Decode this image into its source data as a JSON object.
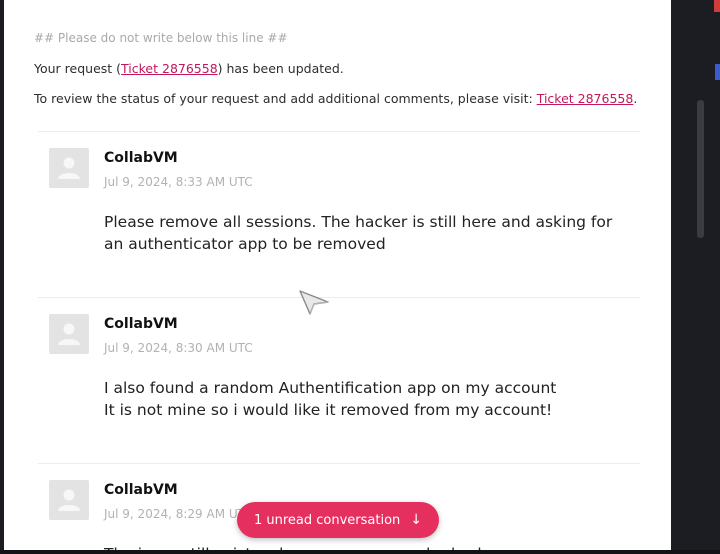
{
  "email": {
    "notice": "## Please do not write below this line ##",
    "line1": {
      "before": "Your request (",
      "link": "Ticket 2876558",
      "after": ") has been updated."
    },
    "line2": {
      "before": "To review the status of your request and add additional comments, please visit: ",
      "link": "Ticket 2876558",
      "after": "."
    },
    "comments": [
      {
        "author": "CollabVM",
        "timestamp": "Jul 9, 2024, 8:33 AM UTC",
        "lines": [
          "Please remove all sessions. The hacker is still here and asking for",
          "an authenticator app to be removed"
        ]
      },
      {
        "author": "CollabVM",
        "timestamp": "Jul 9, 2024, 8:30 AM UTC",
        "lines": [
          "I also found a random Authentification app on my account",
          "It is not mine so i would like it removed from my account!"
        ]
      },
      {
        "author": "CollabVM",
        "timestamp": "Jul 9, 2024, 8:29 AM UTC",
        "lines": [
          "The issue still exists, please remove my shadowban"
        ]
      }
    ]
  },
  "unread_button": {
    "label": "1 unread conversation",
    "icon": "arrow-down-icon",
    "color": "#e5305f"
  },
  "colors": {
    "link": "#c2185b",
    "background_dark": "#1c1d22"
  }
}
